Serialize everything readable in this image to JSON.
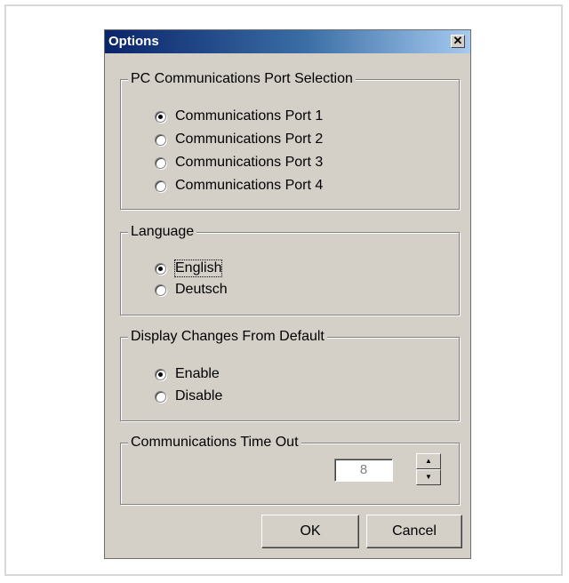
{
  "window": {
    "title": "Options",
    "close_glyph": "✕"
  },
  "port_group": {
    "legend": "PC Communications Port Selection",
    "options": [
      {
        "label": "Communications Port 1",
        "selected": true
      },
      {
        "label": "Communications Port 2",
        "selected": false
      },
      {
        "label": "Communications Port 3",
        "selected": false
      },
      {
        "label": "Communications Port 4",
        "selected": false
      }
    ]
  },
  "language_group": {
    "legend": "Language",
    "options": [
      {
        "label": "English",
        "selected": true
      },
      {
        "label": "Deutsch",
        "selected": false
      }
    ]
  },
  "display_group": {
    "legend": "Display Changes From Default",
    "options": [
      {
        "label": "Enable",
        "selected": true
      },
      {
        "label": "Disable",
        "selected": false
      }
    ]
  },
  "timeout_group": {
    "legend": "Communications Time Out",
    "value": "8"
  },
  "buttons": {
    "ok": "OK",
    "cancel": "Cancel"
  },
  "colors": {
    "dialog_bg": "#d4d0c8",
    "titlebar_start": "#0a246a",
    "titlebar_end": "#a6caf0"
  },
  "icons": {
    "close": "close-icon",
    "spin_up": "spin-up-icon",
    "spin_down": "spin-down-icon"
  }
}
